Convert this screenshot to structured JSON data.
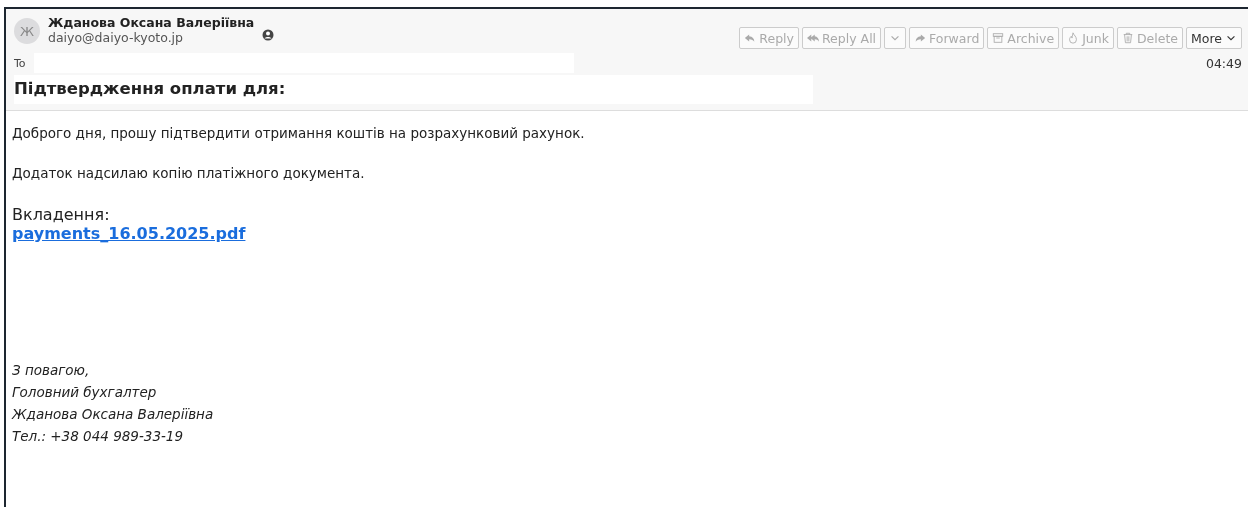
{
  "sender": {
    "avatar": "Ж",
    "name": "Жданова Оксана Валеріївна",
    "email": "daiyo@daiyo-kyoto.jp"
  },
  "toolbar": [
    {
      "kind": "reply",
      "label": "Reply",
      "disabled": true
    },
    {
      "kind": "reply-all",
      "label": "Reply All",
      "disabled": true
    },
    {
      "kind": "dropdown",
      "disabled": true
    },
    {
      "kind": "forward",
      "label": "Forward",
      "disabled": true
    },
    {
      "kind": "archive",
      "label": "Archive",
      "disabled": true
    },
    {
      "kind": "junk",
      "label": "Junk",
      "disabled": true
    },
    {
      "kind": "delete",
      "label": "Delete",
      "disabled": true
    },
    {
      "kind": "more",
      "label": "More",
      "disabled": false
    }
  ],
  "to_label": "To",
  "time": "04:49",
  "subject": "Підтвердження оплати для:",
  "body": {
    "paragraphs": [
      "Доброго дня, прошу підтвердити отримання коштів на розрахунковий рахунок.",
      "Додаток надсилаю копію платіжного документа."
    ],
    "attachments_label": "Вкладення:",
    "attachment_link": "payments_16.05.2025.pdf",
    "signature": [
      "З повагою,",
      "Головний бухгалтер",
      "Жданова Оксана Валеріївна",
      "Тел.: +38 044 989-33-19"
    ]
  }
}
